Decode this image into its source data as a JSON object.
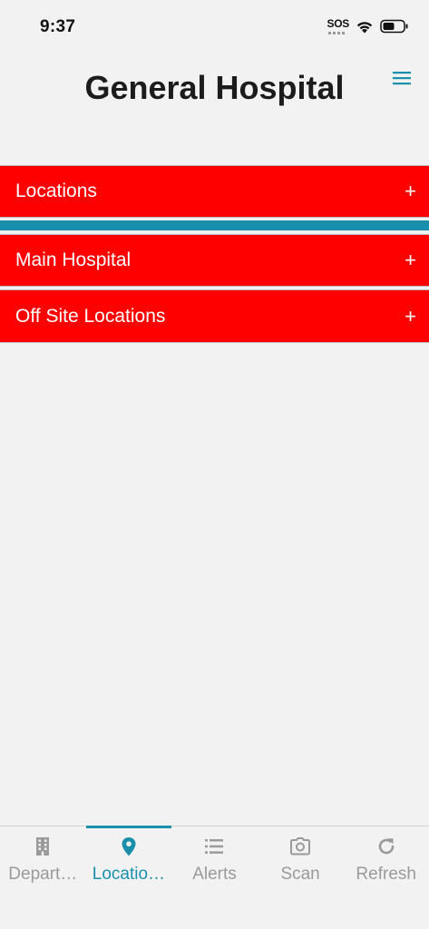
{
  "status_bar": {
    "time": "9:37",
    "sos": "SOS",
    "icons": [
      "sos-icon",
      "wifi-icon",
      "battery-icon"
    ]
  },
  "header": {
    "title": "General Hospital",
    "menu_icon": "hamburger-menu-icon"
  },
  "sections": [
    {
      "label": "Locations",
      "expand_symbol": "+"
    },
    {
      "label": "Main Hospital",
      "expand_symbol": "+"
    },
    {
      "label": "Off Site Locations",
      "expand_symbol": "+"
    }
  ],
  "tabs": [
    {
      "label": "Depart…",
      "icon": "building-icon",
      "active": false
    },
    {
      "label": "Locatio…",
      "icon": "map-pin-icon",
      "active": true
    },
    {
      "label": "Alerts",
      "icon": "list-icon",
      "active": false
    },
    {
      "label": "Scan",
      "icon": "camera-icon",
      "active": false
    },
    {
      "label": "Refresh",
      "icon": "refresh-icon",
      "active": false
    }
  ],
  "colors": {
    "row_background": "#ff0000",
    "accent": "#1a8fab",
    "page_background": "#f2f2f2",
    "inactive_tab": "#9a9a9a"
  }
}
